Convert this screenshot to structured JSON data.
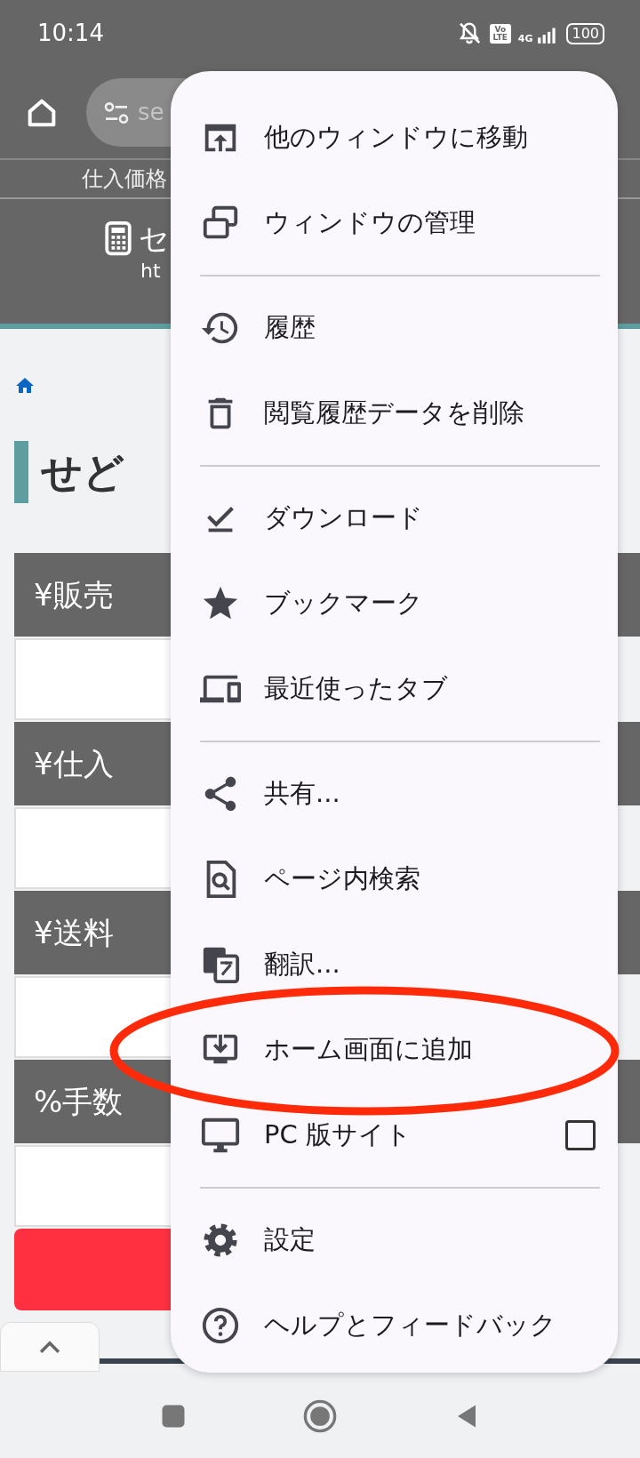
{
  "status_bar": {
    "time": "10:14",
    "volte": "Vo LTE",
    "network": "4G",
    "battery": "100"
  },
  "toolbar": {
    "url_partial": "se"
  },
  "page": {
    "nav_label": "仕入価格",
    "header_title": "セ",
    "header_url": "ht",
    "title": "せど",
    "fields": [
      {
        "label": "¥販売"
      },
      {
        "label": "¥仕入"
      },
      {
        "label": "¥送料"
      },
      {
        "label": "%手数"
      }
    ]
  },
  "menu": {
    "sections": [
      {
        "items": [
          {
            "label": "他のウィンドウに移動",
            "kind": "action",
            "circled": false
          },
          {
            "label": "ウィンドウの管理",
            "kind": "action",
            "circled": false
          }
        ]
      },
      {
        "items": [
          {
            "label": "履歴",
            "kind": "action",
            "circled": false
          },
          {
            "label": "閲覧履歴データを削除",
            "kind": "action",
            "circled": false
          }
        ]
      },
      {
        "items": [
          {
            "label": "ダウンロード",
            "kind": "action",
            "circled": false
          },
          {
            "label": "ブックマーク",
            "kind": "action",
            "circled": false
          },
          {
            "label": "最近使ったタブ",
            "kind": "action",
            "circled": false
          }
        ]
      },
      {
        "items": [
          {
            "label": "共有...",
            "kind": "action",
            "circled": false
          },
          {
            "label": "ページ内検索",
            "kind": "action",
            "circled": false
          },
          {
            "label": "翻訳...",
            "kind": "action",
            "circled": false
          },
          {
            "label": "ホーム画面に追加",
            "kind": "action",
            "circled": true
          },
          {
            "label": "PC 版サイト",
            "kind": "checkbox",
            "checked": false,
            "circled": false
          }
        ]
      },
      {
        "items": [
          {
            "label": "設定",
            "kind": "action",
            "circled": false
          },
          {
            "label": "ヘルプとフィードバック",
            "kind": "action",
            "circled": false
          }
        ]
      }
    ]
  }
}
